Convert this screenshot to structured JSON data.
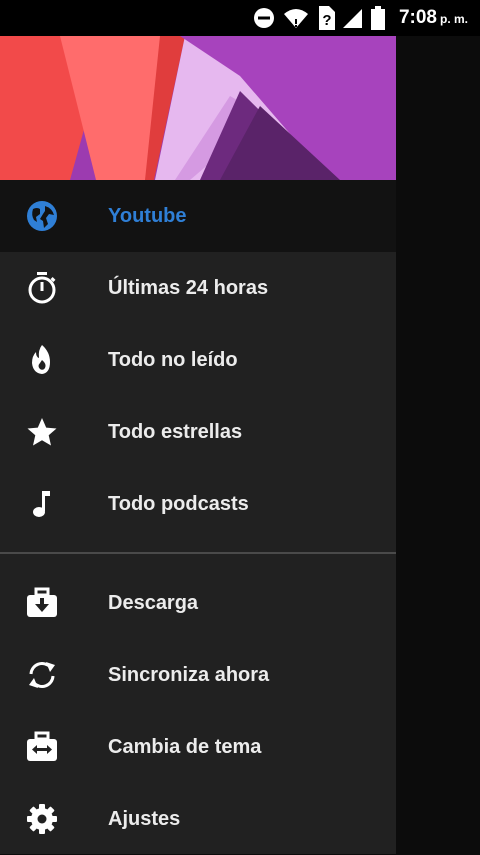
{
  "status_bar": {
    "time": "7:08",
    "ampm": "p. m.",
    "icons": [
      "do-not-disturb-icon",
      "wifi-icon",
      "unknown-sim-icon",
      "signal-icon",
      "battery-icon"
    ]
  },
  "drawer": {
    "header_colors": [
      "#f24a4a",
      "#ff6f6f",
      "#e03d3d",
      "#b13fc2",
      "#9c3bb0",
      "#e6b8ef",
      "#7b2a8c"
    ],
    "accent": "#2f7fd6",
    "items": [
      {
        "id": "youtube",
        "label": "Youtube",
        "icon": "globe-icon",
        "selected": true
      },
      {
        "id": "last-24-hours",
        "label": "Últimas 24 horas",
        "icon": "timer-icon",
        "selected": false
      },
      {
        "id": "all-unread",
        "label": "Todo no leído",
        "icon": "flame-icon",
        "selected": false
      },
      {
        "id": "all-starred",
        "label": "Todo estrellas",
        "icon": "star-icon",
        "selected": false
      },
      {
        "id": "all-podcasts",
        "label": "Todo podcasts",
        "icon": "music-note-icon",
        "selected": false
      }
    ],
    "actions": [
      {
        "id": "download",
        "label": "Descarga",
        "icon": "download-case-icon"
      },
      {
        "id": "sync-now",
        "label": "Sincroniza ahora",
        "icon": "sync-icon"
      },
      {
        "id": "change-theme",
        "label": "Cambia de tema",
        "icon": "swap-case-icon"
      },
      {
        "id": "settings",
        "label": "Ajustes",
        "icon": "gear-icon"
      }
    ]
  }
}
